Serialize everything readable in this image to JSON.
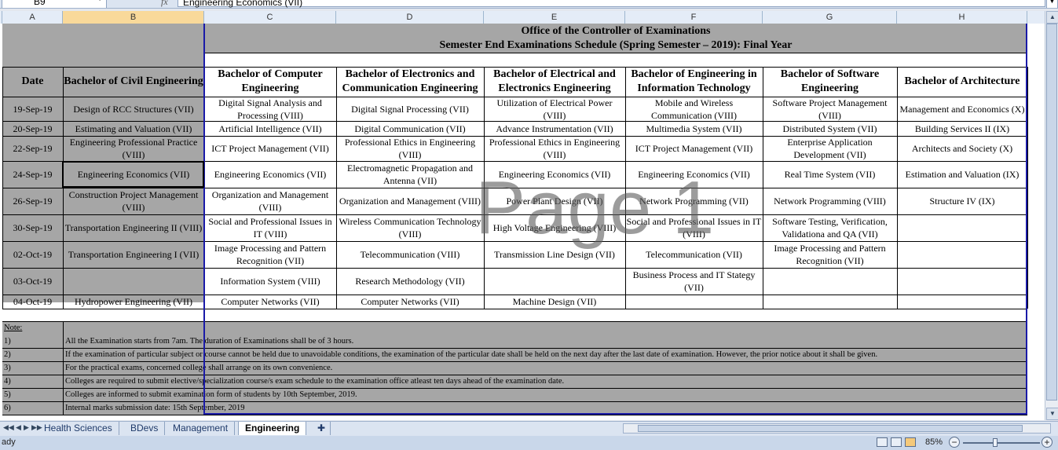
{
  "formula_bar": {
    "name_box": "B9",
    "fx": "fx",
    "formula": "Engineering Economics (VII)"
  },
  "columns": [
    "A",
    "B",
    "C",
    "D",
    "E",
    "F",
    "G",
    "H"
  ],
  "title": {
    "line1": "Office of the Controller of Examinations",
    "line2": "Semester End Examinations Schedule (Spring Semester – 2019): Final Year"
  },
  "headers": {
    "date": "Date",
    "civil": "Bachelor of Civil Engineering",
    "computer": "Bachelor of Computer Engineering",
    "electronics": "Bachelor of Electronics and Communication Engineering",
    "electrical": "Bachelor of Electrical and Electronics Engineering",
    "it": "Bachelor of Engineering in Information Technology",
    "software": "Bachelor of Software Engineering",
    "architecture": "Bachelor of Architecture"
  },
  "rows": [
    {
      "date": "19-Sep-19",
      "civil": "Design of RCC Structures (VII)",
      "computer": "Digital Signal Analysis and Processing (VIII)",
      "electronics": "Digital Signal Processing (VII)",
      "electrical": "Utilization of Electrical Power (VIII)",
      "it": "Mobile and Wireless Communication (VIII)",
      "software": "Software Project Management (VIII)",
      "architecture": "Management and Economics (X)"
    },
    {
      "date": "20-Sep-19",
      "civil": "Estimating and Valuation (VII)",
      "computer": "Artificial Intelligence (VII)",
      "electronics": "Digital Communication (VII)",
      "electrical": "Advance Instrumentation (VII)",
      "it": "Multimedia System (VII)",
      "software": "Distributed System (VII)",
      "architecture": "Building Services II (IX)"
    },
    {
      "date": "22-Sep-19",
      "civil": "Engineering Professional Practice (VIII)",
      "computer": "ICT Project Management (VII)",
      "electronics": "Professional Ethics in Engineering (VIII)",
      "electrical": "Professional Ethics in Engineering (VIII)",
      "it": "ICT Project Management (VII)",
      "software": "Enterprise Application Development (VII)",
      "architecture": "Architects and Society (X)"
    },
    {
      "date": "24-Sep-19",
      "civil": "Engineering Economics (VII)",
      "computer": "Engineering Economics (VII)",
      "electronics": "Electromagnetic Propagation and Antenna (VII)",
      "electrical": "Engineering Economics (VII)",
      "it": "Engineering Economics (VII)",
      "software": "Real Time System (VII)",
      "architecture": "Estimation and Valuation (IX)"
    },
    {
      "date": "26-Sep-19",
      "civil": "Construction Project Management (VIII)",
      "computer": "Organization and Management (VIII)",
      "electronics": "Organization and Management (VIII)",
      "electrical": "Power Plant Design (VII)",
      "it": "Network Programming (VII)",
      "software": "Network Programming (VIII)",
      "architecture": "Structure IV (IX)"
    },
    {
      "date": "30-Sep-19",
      "civil": "Transportation Engineering II (VIII)",
      "computer": "Social and Professional Issues in IT (VIII)",
      "electronics": "Wireless Communication Technology (VIII)",
      "electrical": "High Voltage Engineering (VIII)",
      "it": "Social and Professional Issues in IT (VIII)",
      "software": "Software Testing, Verification, Validationa and QA (VII)",
      "architecture": ""
    },
    {
      "date": "02-Oct-19",
      "civil": "Transportation Engineering I (VII)",
      "computer": "Image Processing and Pattern Recognition (VII)",
      "electronics": "Telecommunication (VIII)",
      "electrical": "Transmission Line Design (VII)",
      "it": "Telecommunication (VII)",
      "software": "Image Processing and Pattern Recognition (VII)",
      "architecture": ""
    },
    {
      "date": "03-Oct-19",
      "civil": "",
      "computer": "Information System (VIII)",
      "electronics": "Research Methodology (VII)",
      "electrical": "",
      "it": "Business Process and IT Stategy (VII)",
      "software": "",
      "architecture": ""
    },
    {
      "date": "04-Oct-19",
      "civil": "Hydropower Engineering (VII)",
      "computer": "Computer Networks (VII)",
      "electronics": "Computer Networks (VII)",
      "electrical": "Machine Design (VII)",
      "it": "",
      "software": "",
      "architecture": ""
    }
  ],
  "notes": {
    "heading": "Note:",
    "items": [
      {
        "num": "1)",
        "text": "All the Examination starts from  7am. The duration of Examinations shall be of 3 hours."
      },
      {
        "num": "2)",
        "text": "If the examination of particular subject or course cannot be held due to unavoidable conditions, the examination of the particular date shall be held on the next day after the last date of examination. However, the prior notice about it shall be given."
      },
      {
        "num": "3)",
        "text": "For the practical exams, concerned college shall arrange on its own convenience."
      },
      {
        "num": "4)",
        "text": "Colleges are required to submit elective/specialization course/s exam schedule to the examination office atleast ten days ahead of the examination date."
      },
      {
        "num": "5)",
        "text": "Colleges are informed to submit examination form of students by  10th  September, 2019."
      },
      {
        "num": "6)",
        "text": "Internal marks submission date: 15th September, 2019"
      }
    ]
  },
  "watermark": "Page 1",
  "tabs": [
    "Health Sciences",
    "BDevs",
    "Management",
    "Engineering"
  ],
  "active_tab": "Engineering",
  "status": {
    "text": "ady",
    "zoom": "85%",
    "zoom_minus": "−",
    "zoom_plus": "+"
  },
  "colors": {
    "header_gray": "#a6a6a6",
    "print_border": "#1a1aa8",
    "selected_col": "#f9d99a"
  }
}
